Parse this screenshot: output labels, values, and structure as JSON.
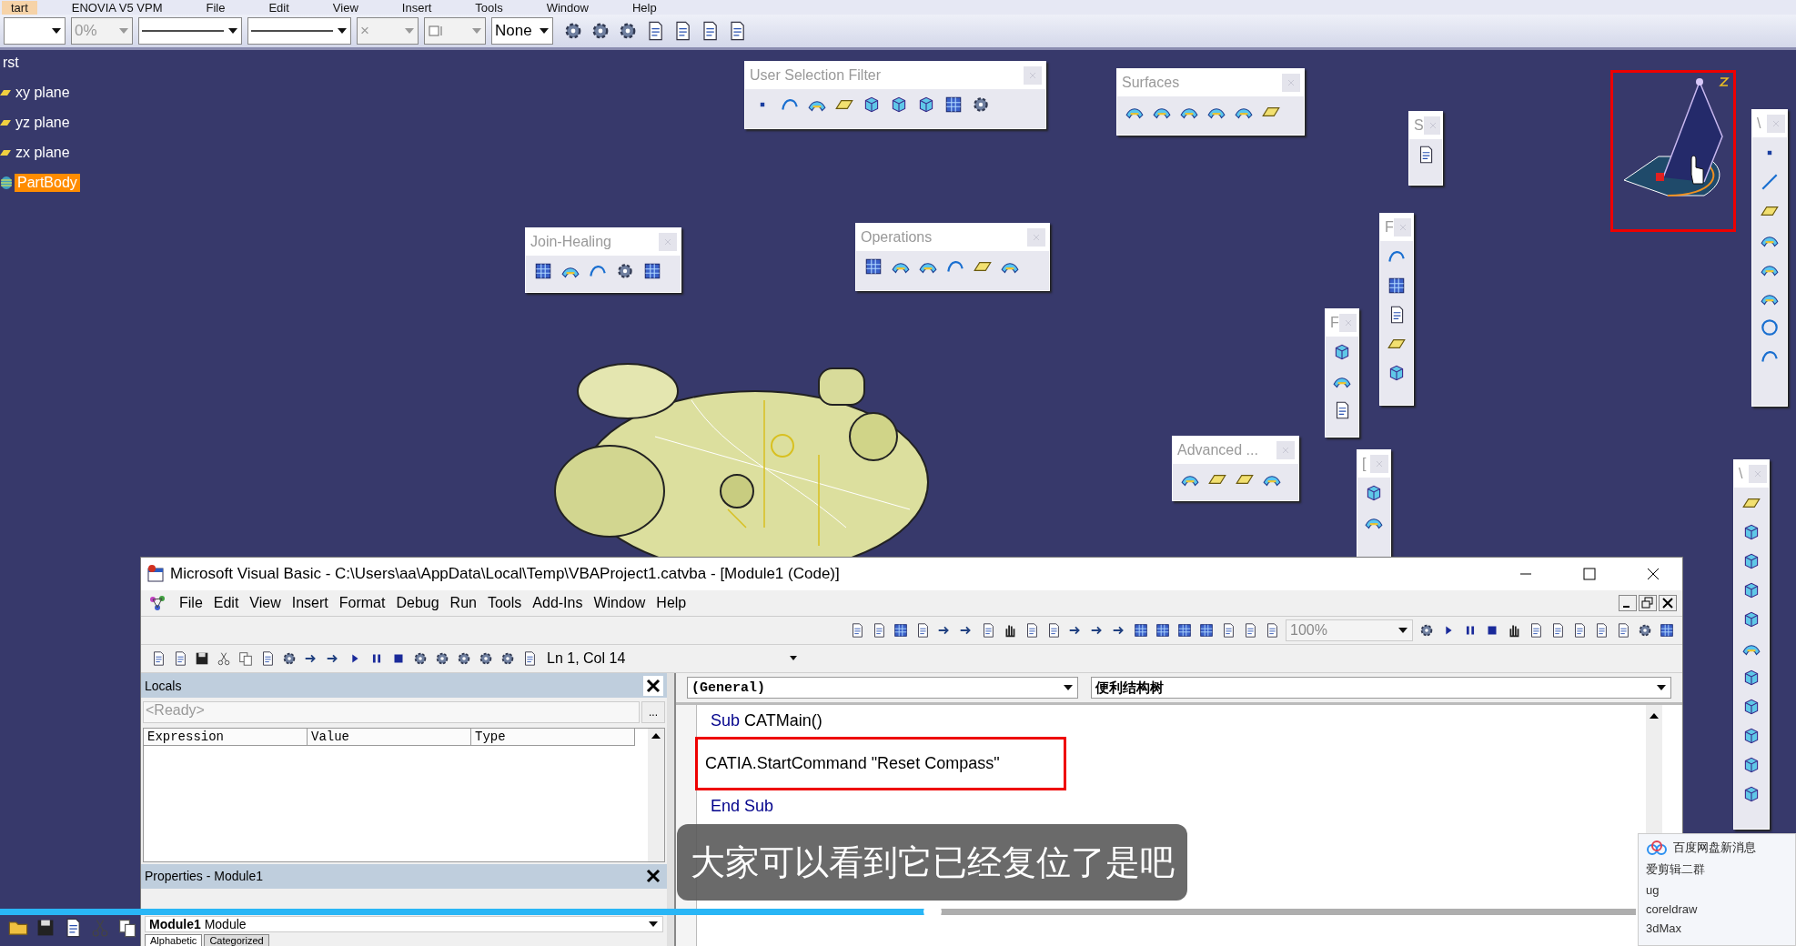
{
  "catia": {
    "menu": [
      {
        "label": "tart",
        "selected": true
      },
      {
        "label": "ENOVIA V5 VPM",
        "selected": false
      },
      {
        "label": "File",
        "selected": false
      },
      {
        "label": "Edit",
        "selected": false
      },
      {
        "label": "View",
        "selected": false
      },
      {
        "label": "Insert",
        "selected": false
      },
      {
        "label": "Tools",
        "selected": false
      },
      {
        "label": "Window",
        "selected": false
      },
      {
        "label": "Help",
        "selected": false
      }
    ],
    "toolbar": [
      {
        "kind": "blank",
        "disabled": false
      },
      {
        "kind": "text",
        "value": "0%",
        "disabled": true
      },
      {
        "kind": "line",
        "disabled": false
      },
      {
        "kind": "line",
        "disabled": false
      },
      {
        "kind": "text",
        "value": "×",
        "disabled": true
      },
      {
        "kind": "icon",
        "disabled": true
      },
      {
        "kind": "text",
        "value": "None",
        "disabled": false
      }
    ],
    "tree": [
      {
        "label": "rst",
        "kind": "root",
        "selected": false
      },
      {
        "label": "xy plane",
        "kind": "plane",
        "selected": false
      },
      {
        "label": "yz plane",
        "kind": "plane",
        "selected": false
      },
      {
        "label": "zx plane",
        "kind": "plane",
        "selected": false
      },
      {
        "label": "PartBody",
        "kind": "body",
        "selected": true
      }
    ],
    "panels": [
      {
        "title": "User Selection Filter",
        "kind": "horizontal"
      },
      {
        "title": "Surfaces",
        "kind": "horizontal"
      },
      {
        "title": "Join-Healing",
        "kind": "horizontal"
      },
      {
        "title": "Operations",
        "kind": "horizontal"
      },
      {
        "title": "Advanced ...",
        "kind": "horizontal"
      },
      {
        "title": "S",
        "kind": "vertical"
      },
      {
        "title": "F",
        "kind": "vertical"
      },
      {
        "title": "F",
        "kind": "vertical"
      },
      {
        "title": "[",
        "kind": "vertical"
      },
      {
        "title": "\\",
        "kind": "vertical"
      },
      {
        "title": "\\",
        "kind": "vertical"
      }
    ]
  },
  "vb": {
    "title": "Microsoft Visual Basic - C:\\Users\\aa\\AppData\\Local\\Temp\\VBAProject1.catvba - [Module1 (Code)]",
    "menu": [
      "File",
      "Edit",
      "View",
      "Insert",
      "Format",
      "Debug",
      "Run",
      "Tools",
      "Add-Ins",
      "Window",
      "Help"
    ],
    "zoom": "100%",
    "position": "Ln 1, Col 14",
    "locals": {
      "title": "Locals",
      "status": "<Ready>",
      "more": "...",
      "columns": [
        "Expression",
        "Value",
        "Type"
      ]
    },
    "properties": {
      "title": "Properties - Module1",
      "object": "Module1",
      "object_type": "Module",
      "tabs": [
        {
          "label": "Alphabetic",
          "selected": true
        },
        {
          "label": "Categorized",
          "selected": false
        }
      ]
    },
    "code": {
      "object": "(General)",
      "procedure": "便利结构树",
      "lines": [
        {
          "highlighted": false,
          "segments": [
            {
              "text": "Sub",
              "kind": "keyword"
            },
            {
              "text": "CATMain()",
              "kind": "plain"
            }
          ]
        },
        {
          "highlighted": true,
          "segments": [
            {
              "text": "CATIA.StartCommand \"Reset Compass\"",
              "kind": "plain"
            }
          ]
        },
        {
          "highlighted": false,
          "segments": [
            {
              "text": "End Sub",
              "kind": "keyword"
            }
          ]
        }
      ]
    }
  },
  "subtitle": "大家可以看到它已经复位了是吧",
  "video": {
    "level": 0.57
  },
  "notification": {
    "title": "百度网盘新消息",
    "items": [
      "爱剪辑二群",
      "ug",
      "coreldraw",
      "3dMax"
    ]
  }
}
